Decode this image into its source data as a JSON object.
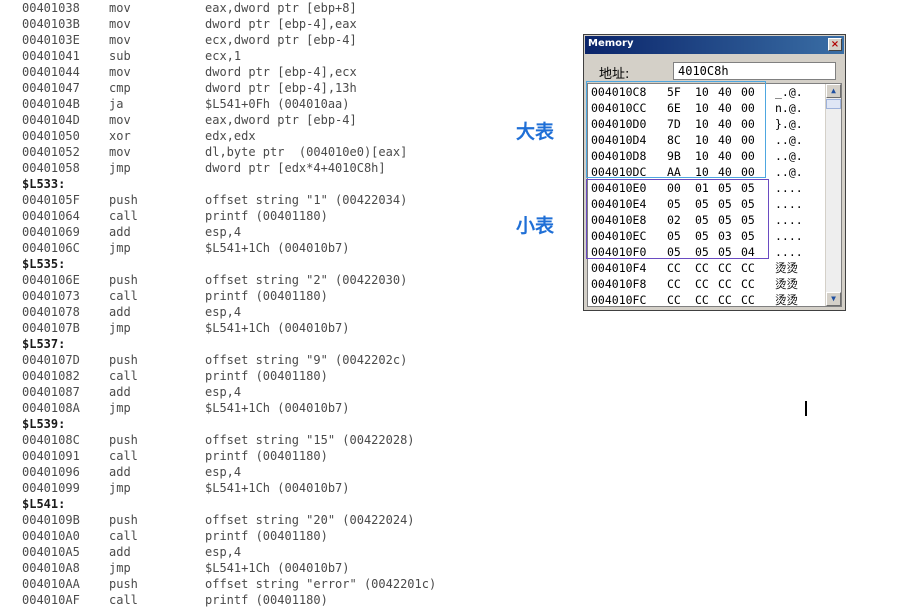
{
  "listing": [
    {
      "addr": "00401038",
      "mn": "mov",
      "op": "eax,dword ptr [ebp+8]"
    },
    {
      "addr": "0040103B",
      "mn": "mov",
      "op": "dword ptr [ebp-4],eax"
    },
    {
      "addr": "0040103E",
      "mn": "mov",
      "op": "ecx,dword ptr [ebp-4]"
    },
    {
      "addr": "00401041",
      "mn": "sub",
      "op": "ecx,1"
    },
    {
      "addr": "00401044",
      "mn": "mov",
      "op": "dword ptr [ebp-4],ecx"
    },
    {
      "addr": "00401047",
      "mn": "cmp",
      "op": "dword ptr [ebp-4],13h"
    },
    {
      "addr": "0040104B",
      "mn": "ja",
      "op": "$L541+0Fh (004010aa)"
    },
    {
      "addr": "0040104D",
      "mn": "mov",
      "op": "eax,dword ptr [ebp-4]"
    },
    {
      "addr": "00401050",
      "mn": "xor",
      "op": "edx,edx"
    },
    {
      "addr": "00401052",
      "mn": "mov",
      "op": "dl,byte ptr  (004010e0)[eax]"
    },
    {
      "addr": "00401058",
      "mn": "jmp",
      "op": "dword ptr [edx*4+4010C8h]"
    },
    {
      "label": "$L533:"
    },
    {
      "addr": "0040105F",
      "mn": "push",
      "op": "offset string \"1\" (00422034)"
    },
    {
      "addr": "00401064",
      "mn": "call",
      "op": "printf (00401180)"
    },
    {
      "addr": "00401069",
      "mn": "add",
      "op": "esp,4"
    },
    {
      "addr": "0040106C",
      "mn": "jmp",
      "op": "$L541+1Ch (004010b7)"
    },
    {
      "label": "$L535:"
    },
    {
      "addr": "0040106E",
      "mn": "push",
      "op": "offset string \"2\" (00422030)"
    },
    {
      "addr": "00401073",
      "mn": "call",
      "op": "printf (00401180)"
    },
    {
      "addr": "00401078",
      "mn": "add",
      "op": "esp,4"
    },
    {
      "addr": "0040107B",
      "mn": "jmp",
      "op": "$L541+1Ch (004010b7)"
    },
    {
      "label": "$L537:"
    },
    {
      "addr": "0040107D",
      "mn": "push",
      "op": "offset string \"9\" (0042202c)"
    },
    {
      "addr": "00401082",
      "mn": "call",
      "op": "printf (00401180)"
    },
    {
      "addr": "00401087",
      "mn": "add",
      "op": "esp,4"
    },
    {
      "addr": "0040108A",
      "mn": "jmp",
      "op": "$L541+1Ch (004010b7)"
    },
    {
      "label": "$L539:"
    },
    {
      "addr": "0040108C",
      "mn": "push",
      "op": "offset string \"15\" (00422028)"
    },
    {
      "addr": "00401091",
      "mn": "call",
      "op": "printf (00401180)"
    },
    {
      "addr": "00401096",
      "mn": "add",
      "op": "esp,4"
    },
    {
      "addr": "00401099",
      "mn": "jmp",
      "op": "$L541+1Ch (004010b7)"
    },
    {
      "label": "$L541:"
    },
    {
      "addr": "0040109B",
      "mn": "push",
      "op": "offset string \"20\" (00422024)"
    },
    {
      "addr": "004010A0",
      "mn": "call",
      "op": "printf (00401180)"
    },
    {
      "addr": "004010A5",
      "mn": "add",
      "op": "esp,4"
    },
    {
      "addr": "004010A8",
      "mn": "jmp",
      "op": "$L541+1Ch (004010b7)"
    },
    {
      "addr": "004010AA",
      "mn": "push",
      "op": "offset string \"error\" (0042201c)"
    },
    {
      "addr": "004010AF",
      "mn": "call",
      "op": "printf (00401180)"
    }
  ],
  "annotations": {
    "big_table": "大表",
    "small_table": "小表"
  },
  "memory_window": {
    "title": "Memory",
    "close_glyph": "×",
    "address_label": "地址:",
    "address_value": "4010C8h",
    "scroll_up": "▲",
    "scroll_down": "▼",
    "rows": [
      {
        "addr": "004010C8",
        "bytes": [
          "5F",
          "10",
          "40",
          "00"
        ],
        "ascii": "_.@."
      },
      {
        "addr": "004010CC",
        "bytes": [
          "6E",
          "10",
          "40",
          "00"
        ],
        "ascii": "n.@."
      },
      {
        "addr": "004010D0",
        "bytes": [
          "7D",
          "10",
          "40",
          "00"
        ],
        "ascii": "}.@."
      },
      {
        "addr": "004010D4",
        "bytes": [
          "8C",
          "10",
          "40",
          "00"
        ],
        "ascii": "..@."
      },
      {
        "addr": "004010D8",
        "bytes": [
          "9B",
          "10",
          "40",
          "00"
        ],
        "ascii": "..@."
      },
      {
        "addr": "004010DC",
        "bytes": [
          "AA",
          "10",
          "40",
          "00"
        ],
        "ascii": "..@."
      },
      {
        "addr": "004010E0",
        "bytes": [
          "00",
          "01",
          "05",
          "05"
        ],
        "ascii": "...."
      },
      {
        "addr": "004010E4",
        "bytes": [
          "05",
          "05",
          "05",
          "05"
        ],
        "ascii": "...."
      },
      {
        "addr": "004010E8",
        "bytes": [
          "02",
          "05",
          "05",
          "05"
        ],
        "ascii": "...."
      },
      {
        "addr": "004010EC",
        "bytes": [
          "05",
          "05",
          "03",
          "05"
        ],
        "ascii": "...."
      },
      {
        "addr": "004010F0",
        "bytes": [
          "05",
          "05",
          "05",
          "04"
        ],
        "ascii": "...."
      },
      {
        "addr": "004010F4",
        "bytes": [
          "CC",
          "CC",
          "CC",
          "CC"
        ],
        "ascii": "烫烫"
      },
      {
        "addr": "004010F8",
        "bytes": [
          "CC",
          "CC",
          "CC",
          "CC"
        ],
        "ascii": "烫烫"
      },
      {
        "addr": "004010FC",
        "bytes": [
          "CC",
          "CC",
          "CC",
          "CC"
        ],
        "ascii": "烫烫"
      }
    ]
  },
  "colors": {
    "big_box": "#4ea7e0",
    "small_box": "#6a4bc2",
    "annotation": "#1f6fd6"
  }
}
